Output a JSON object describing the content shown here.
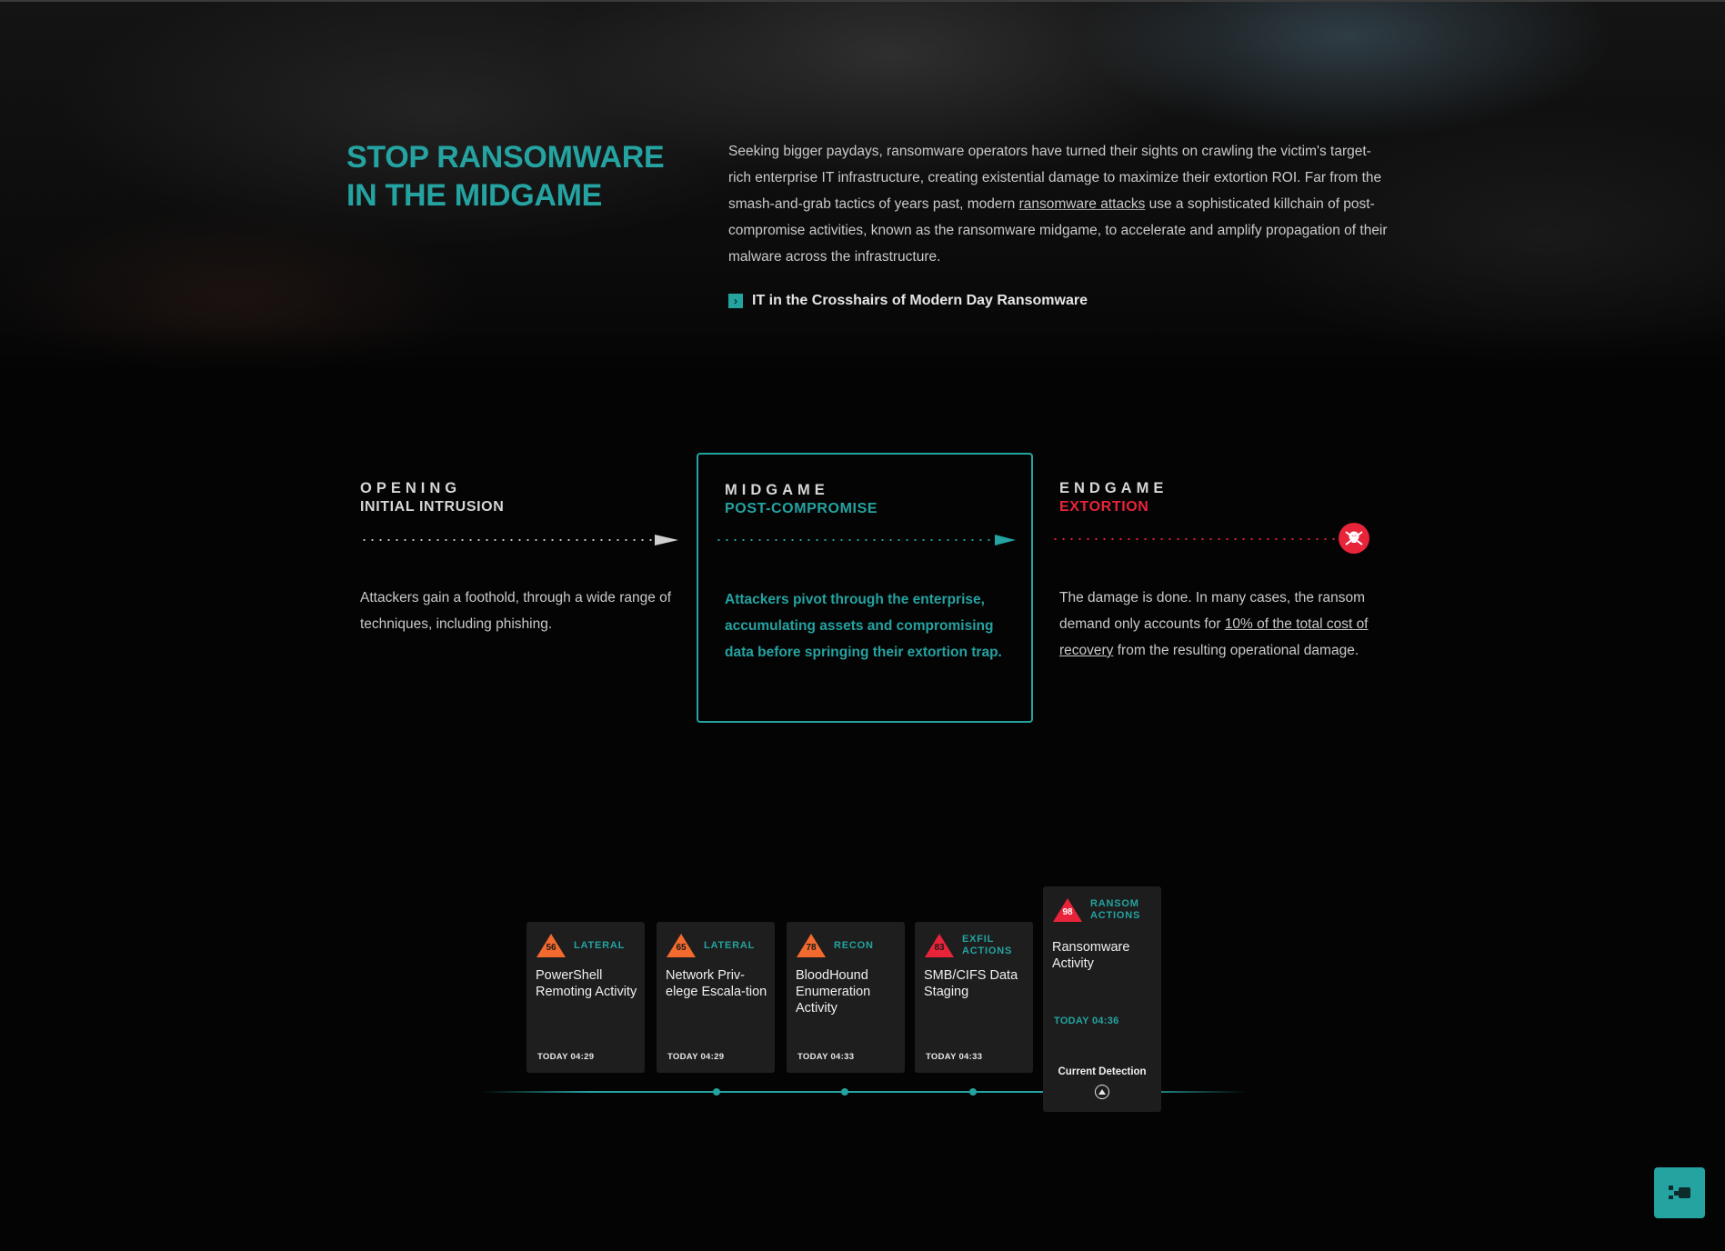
{
  "hero": {
    "title_line1": "STOP RANSOMWARE",
    "title_line2": "IN THE MIDGAME",
    "text_before": "Seeking bigger paydays, ransomware operators have turned their sights on crawling the victim's target-rich enterprise IT infrastructure, creating existential damage to maximize their extortion ROI. Far from the smash-and-grab tactics of years past, modern ",
    "text_link": "ransomware attacks",
    "text_after": " use a sophisticated killchain of post-compromise activities, known as the ransomware midgame, to accelerate and amplify propagation of their malware across the infrastructure.",
    "cta_label": "IT in the Crosshairs of Modern Day Ransomware",
    "cta_icon": "chevron-right-icon"
  },
  "phases": {
    "opening": {
      "label": "OPENING",
      "sub": "INITIAL INTRUSION",
      "desc": "Attackers gain a foothold, through a wide range of techniques, including phishing."
    },
    "midgame": {
      "label": "MIDGAME",
      "sub": "POST-COMPROMISE",
      "desc": "Attackers pivot through the enterprise, accumulating assets and compromising data before springing their extortion trap."
    },
    "endgame": {
      "label": "ENDGAME",
      "sub": "EXTORTION",
      "desc_before": "The damage is done. In many cases, the ransom demand only accounts for ",
      "desc_link": "10% of the total cost of recovery",
      "desc_after": " from the resulting operational damage.",
      "icon": "skull-icon"
    }
  },
  "detections": [
    {
      "score": "56",
      "category": "LATERAL",
      "title": "PowerShell Remoting Activity",
      "time": "TODAY 04:29",
      "color": "#f26a2e"
    },
    {
      "score": "65",
      "category": "LATERAL",
      "title": "Network Priv-elege Escala-tion",
      "time": "TODAY 04:29",
      "color": "#f26a2e"
    },
    {
      "score": "78",
      "category": "RECON",
      "title": "BloodHound Enumeration Activity",
      "time": "TODAY 04:33",
      "color": "#f26a2e"
    },
    {
      "score": "83",
      "category": "EXFIL ACTIONS",
      "title": "SMB/CIFS Data Staging",
      "time": "TODAY 04:33",
      "color": "#e8243a"
    }
  ],
  "current": {
    "score": "98",
    "category": "RANSOM ACTIONS",
    "title": "Ransomware Activity",
    "time": "TODAY 04:36",
    "label": "Current Detection",
    "color": "#e8243a"
  },
  "colors": {
    "accent": "#24a3a1",
    "danger": "#e8243a",
    "warn": "#f26a2e"
  },
  "chat_icon": "chat-icon"
}
